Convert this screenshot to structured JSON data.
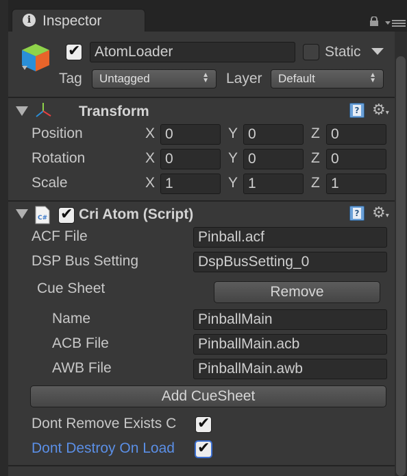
{
  "tab": {
    "title": "Inspector"
  },
  "gameobject": {
    "active": true,
    "name": "AtomLoader",
    "static_label": "Static",
    "static_checked": false,
    "tag_label": "Tag",
    "tag_value": "Untagged",
    "layer_label": "Layer",
    "layer_value": "Default"
  },
  "transform": {
    "title": "Transform",
    "rows": [
      {
        "label": "Position",
        "x": "0",
        "y": "0",
        "z": "0"
      },
      {
        "label": "Rotation",
        "x": "0",
        "y": "0",
        "z": "0"
      },
      {
        "label": "Scale",
        "x": "1",
        "y": "1",
        "z": "1"
      }
    ],
    "axis_x": "X",
    "axis_y": "Y",
    "axis_z": "Z"
  },
  "script": {
    "icon_text": "C#",
    "title": "Cri Atom (Script)",
    "enabled": true,
    "acf_label": "ACF File",
    "acf_value": "Pinball.acf",
    "dsp_label": "DSP Bus Setting",
    "dsp_value": "DspBusSetting_0",
    "cue_sheet_label": "Cue Sheet",
    "remove_label": "Remove",
    "name_label": "Name",
    "name_value": "PinballMain",
    "acb_label": "ACB File",
    "acb_value": "PinballMain.acb",
    "awb_label": "AWB File",
    "awb_value": "PinballMain.awb",
    "add_cuesheet_label": "Add CueSheet",
    "dont_remove_label": "Dont Remove Exists C",
    "dont_remove_checked": true,
    "dont_destroy_label": "Dont Destroy On Load",
    "dont_destroy_checked": true
  },
  "colors": {
    "background": "#383838",
    "tabbar": "#242424",
    "highlight_label": "#5b8fe6",
    "help_icon": "#6aa0d8"
  }
}
